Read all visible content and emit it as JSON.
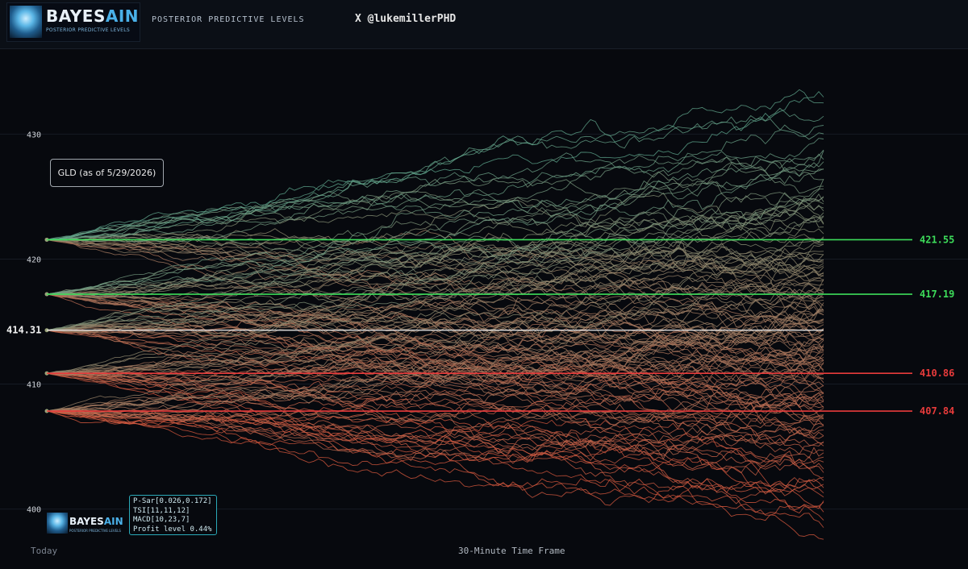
{
  "header": {
    "logo_word": "BAYES",
    "logo_word_accent": "AIN",
    "logo_tagline": "POSTERIOR PREDICTIVE LEVELS",
    "title": "POSTERIOR PREDICTIVE LEVELS",
    "handle": "X @lukemillerPHD"
  },
  "badge": {
    "label": "GLD (as of 5/29/2026)"
  },
  "params": {
    "lines": [
      "P-Sar[0.026,0.172]",
      "TSI[11,11,12]",
      "MACD[10,23,7]",
      "Profit level 0.44%"
    ]
  },
  "footer": {
    "left": "Today",
    "center": "30-Minute Time Frame"
  },
  "chart_data": {
    "type": "line",
    "title": "",
    "xlabel": "30-Minute Time Frame",
    "ylabel": "",
    "x_start_label": "Today",
    "ylim": [
      397.2,
      436.8
    ],
    "yticks": [
      400,
      410,
      420,
      430
    ],
    "grid": true,
    "current_price": {
      "value": 414.31,
      "label": "414.31",
      "color": "#e6e6e6"
    },
    "levels": [
      {
        "value": 421.55,
        "label": "421.55",
        "color": "#3ddc5a"
      },
      {
        "value": 417.19,
        "label": "417.19",
        "color": "#3ddc5a"
      },
      {
        "value": 410.86,
        "label": "410.86",
        "color": "#e83b3b"
      },
      {
        "value": 407.84,
        "label": "407.84",
        "color": "#e83b3b"
      }
    ],
    "simulation_fans": [
      {
        "start": 421.55,
        "paths": 30,
        "end_range": [
          411.5,
          433.5
        ]
      },
      {
        "start": 417.19,
        "paths": 30,
        "end_range": [
          407.0,
          429.0
        ]
      },
      {
        "start": 414.31,
        "paths": 30,
        "end_range": [
          405.0,
          425.0
        ]
      },
      {
        "start": 410.86,
        "paths": 30,
        "end_range": [
          400.5,
          420.5
        ]
      },
      {
        "start": 407.84,
        "paths": 30,
        "end_range": [
          397.5,
          417.5
        ]
      }
    ],
    "path_color_low": "#d9583e",
    "path_color_high": "#5fa88e"
  }
}
